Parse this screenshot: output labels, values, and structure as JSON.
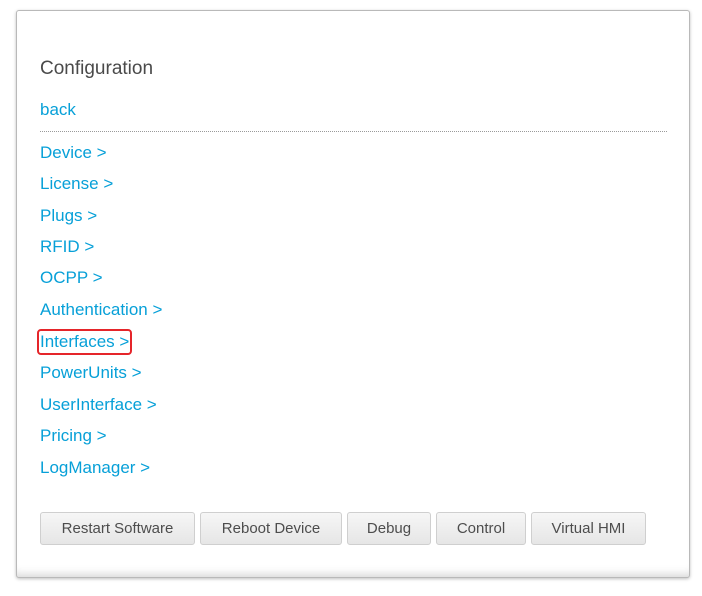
{
  "page": {
    "title": "Configuration",
    "back_label": "back"
  },
  "menu": {
    "items": [
      {
        "label": "Device >"
      },
      {
        "label": "License >"
      },
      {
        "label": "Plugs >"
      },
      {
        "label": "RFID >"
      },
      {
        "label": "OCPP >"
      },
      {
        "label": "Authentication >"
      },
      {
        "label": "Interfaces >",
        "highlighted": true
      },
      {
        "label": "PowerUnits >"
      },
      {
        "label": "UserInterface >"
      },
      {
        "label": "Pricing >"
      },
      {
        "label": "LogManager >"
      }
    ]
  },
  "buttons": [
    {
      "label": "Restart Software"
    },
    {
      "label": "Reboot Device"
    },
    {
      "label": "Debug"
    },
    {
      "label": "Control"
    },
    {
      "label": "Virtual HMI"
    }
  ],
  "colors": {
    "link": "#07a0d8",
    "highlight_border": "#e5252a",
    "title": "#4a4a4a"
  }
}
